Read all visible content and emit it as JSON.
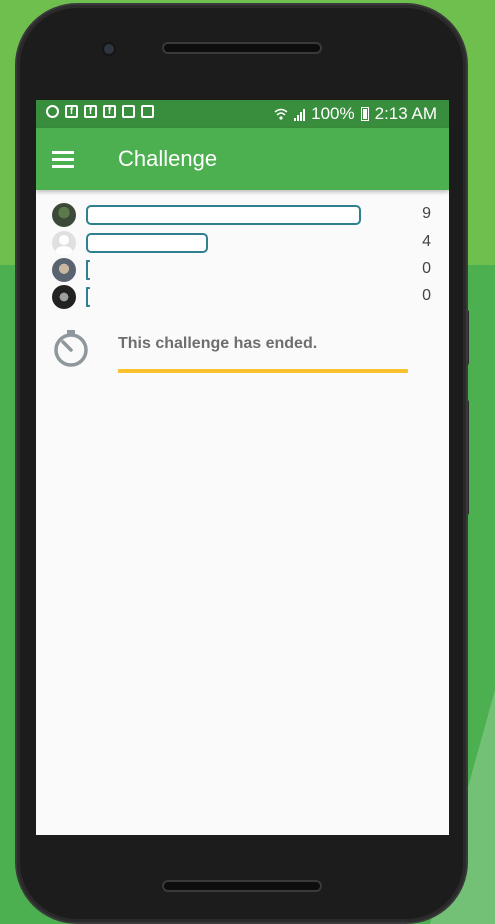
{
  "status_bar": {
    "battery": "100%",
    "time": "2:13 AM",
    "notification_icons": [
      "do-not-disturb-icon",
      "facebook-icon",
      "facebook-icon",
      "facebook-icon",
      "calendar-icon",
      "exchange-icon"
    ]
  },
  "app_bar": {
    "title": "Challenge",
    "menu_icon": "hamburger-menu-icon",
    "color": "#4caf50"
  },
  "leaderboard": [
    {
      "score": "9",
      "progress": 0.9
    },
    {
      "score": "4",
      "progress": 0.4
    },
    {
      "score": "0",
      "progress": 0
    },
    {
      "score": "0",
      "progress": 0
    }
  ],
  "status": {
    "message": "This challenge has ended.",
    "icon": "timer-icon",
    "accent": "#fbc02d"
  }
}
